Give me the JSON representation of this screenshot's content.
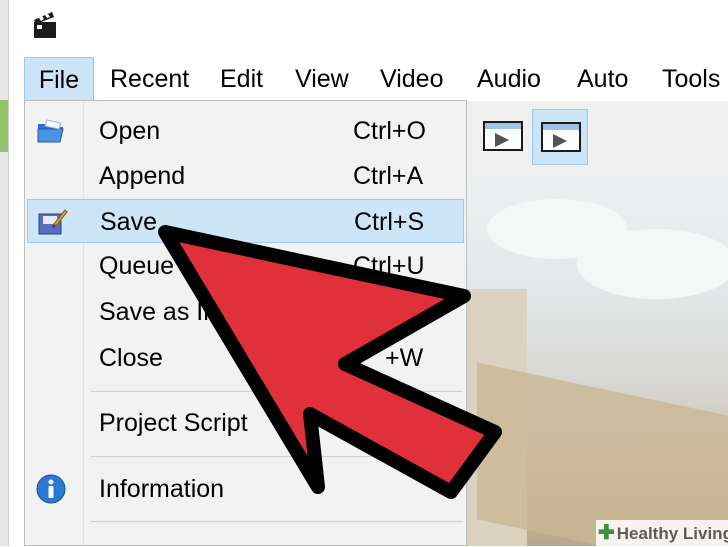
{
  "menubar": {
    "items": [
      "File",
      "Recent",
      "Edit",
      "View",
      "Video",
      "Audio",
      "Auto",
      "Tools"
    ]
  },
  "file_menu": {
    "items": [
      {
        "label": "Open",
        "shortcut": "Ctrl+O",
        "icon": "open-folder-icon"
      },
      {
        "label": "Append",
        "shortcut": "Ctrl+A"
      },
      {
        "label": "Save",
        "shortcut": "Ctrl+S",
        "icon": "save-icon",
        "highlighted": true
      },
      {
        "label": "Queue",
        "shortcut": "Ctrl+U"
      },
      {
        "label": "Save as In",
        "shortcut": ""
      },
      {
        "label": "Close",
        "shortcut": "+W"
      },
      {
        "label": "Project Script",
        "shortcut": ""
      },
      {
        "label": "Information",
        "shortcut": "",
        "icon": "info-icon"
      }
    ]
  },
  "watermark": {
    "text": "Healthy Living",
    "icon": "plus-icon"
  },
  "colors": {
    "menu_highlight": "#cde6f7",
    "menu_highlight_border": "#99c9ef",
    "pointer_arrow": "#e0303a",
    "pointer_outline": "#000000"
  }
}
